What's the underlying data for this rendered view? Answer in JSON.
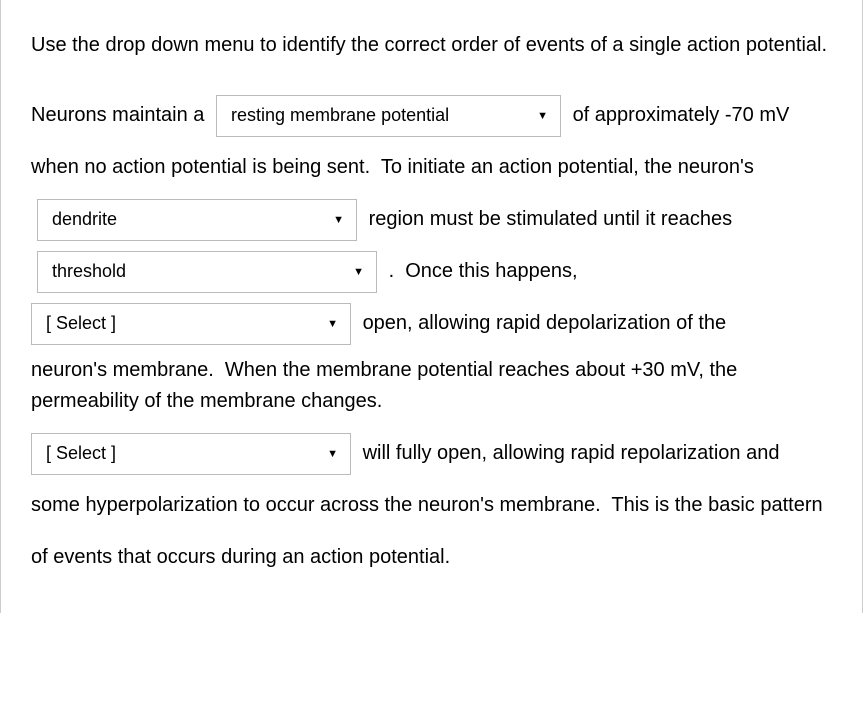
{
  "instruction": "Use the drop down menu to identify the correct order of events of a single action potential.",
  "text": {
    "t1": "Neurons maintain a",
    "t2": "of approximately -70 mV when no action potential is being sent.  To initiate an action potential, the neuron's",
    "t3": "region must be stimulated until it reaches",
    "t4": ".  Once this happens,",
    "t5a": "open, allowing rapid depolarization of the",
    "t5b": "neuron's membrane.  When the membrane potential reaches about +30 mV, the permeability of the membrane changes.",
    "t6": "will fully open, allowing rapid repolarization and some hyperpolarization to occur across the neuron's membrane.  This is the basic pattern of events that occurs during an action potential."
  },
  "dropdowns": {
    "d1": "resting membrane potential",
    "d2": "dendrite",
    "d3": "threshold",
    "d4": "[ Select ]",
    "d5": "[ Select ]"
  }
}
